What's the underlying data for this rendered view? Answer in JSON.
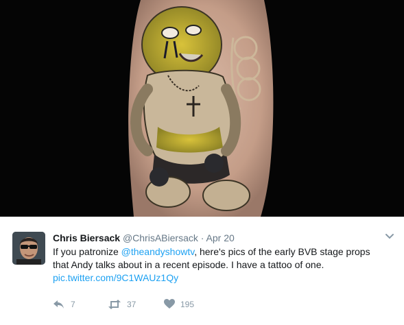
{
  "tweet": {
    "name": "Chris Biersack",
    "handle": "@ChrisABiersack",
    "separator": "·",
    "date": "Apr 20",
    "text_before": "If you patronize ",
    "mention": "@theandyshowtv",
    "text_line1_after": ", here's pics of the early BVB stage props",
    "text_line2": "that Andy talks about in a recent episode. I have a tattoo of one.",
    "link": "pic.twitter.com/9C1WAUz1Qy"
  },
  "actions": {
    "reply_count": "7",
    "retweet_count": "37",
    "like_count": "195"
  },
  "icons": {
    "reply": "reply-icon",
    "retweet": "retweet-icon",
    "like": "heart-icon",
    "more": "chevron-down-icon"
  },
  "colors": {
    "link": "#1da1f2",
    "text": "#14171a",
    "muted": "#657786",
    "action_gray": "#8899a6"
  }
}
